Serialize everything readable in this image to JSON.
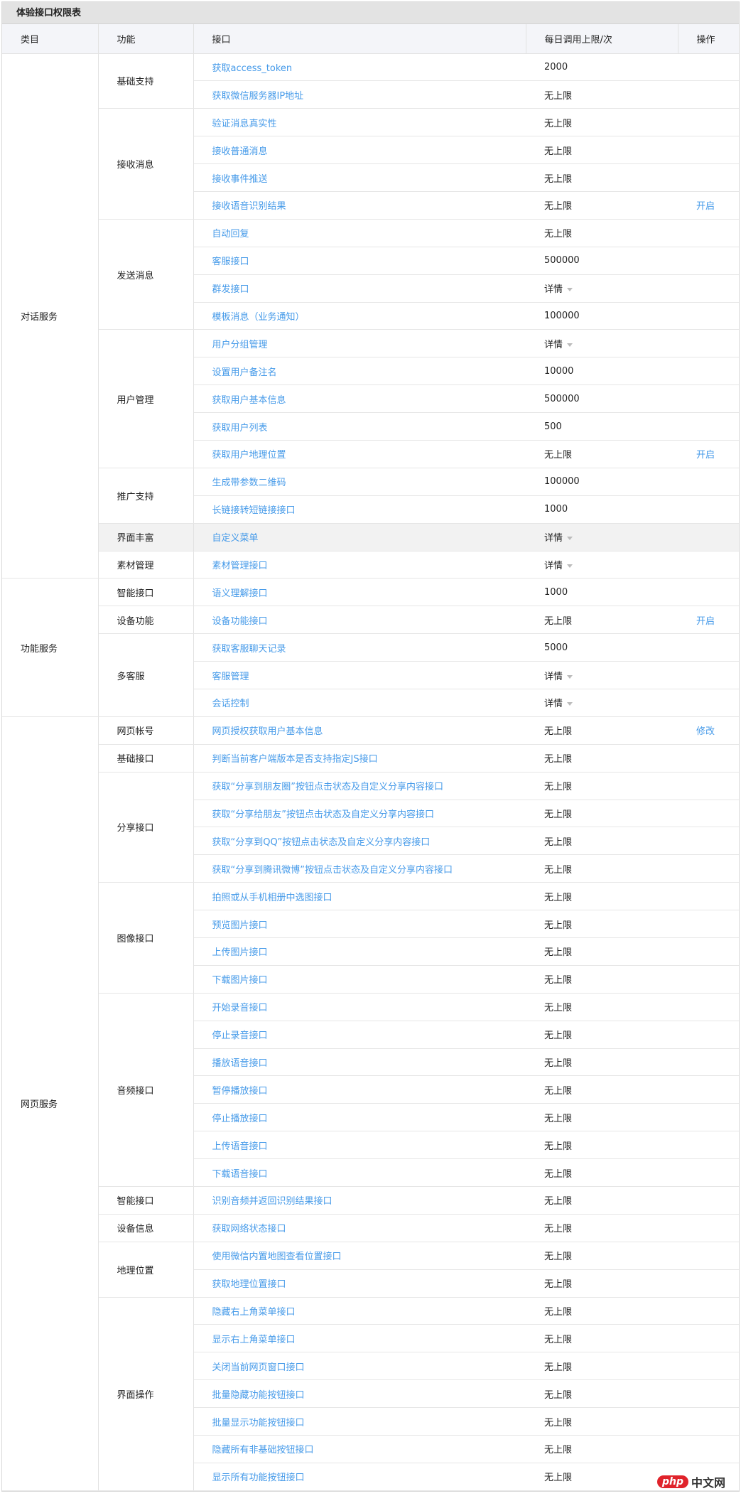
{
  "title": "体验接口权限表",
  "headers": [
    "类目",
    "功能",
    "接口",
    "每日调用上限/次",
    "操作"
  ],
  "colors": {
    "link": "#459ae9",
    "header_bg": "#f4f5f9",
    "title_bg": "#e3e3e3"
  },
  "categories": [
    {
      "name": "对话服务",
      "groups": [
        {
          "name": "基础支持",
          "apis": [
            {
              "name": "获取access_token",
              "limit": "2000"
            },
            {
              "name": "获取微信服务器IP地址",
              "limit": "无上限"
            }
          ]
        },
        {
          "name": "接收消息",
          "apis": [
            {
              "name": "验证消息真实性",
              "limit": "无上限"
            },
            {
              "name": "接收普通消息",
              "limit": "无上限"
            },
            {
              "name": "接收事件推送",
              "limit": "无上限"
            },
            {
              "name": "接收语音识别结果",
              "limit": "无上限",
              "action": "开启"
            }
          ]
        },
        {
          "name": "发送消息",
          "apis": [
            {
              "name": "自动回复",
              "limit": "无上限"
            },
            {
              "name": "客服接口",
              "limit": "500000"
            },
            {
              "name": "群发接口",
              "limit": "详情",
              "dropdown": true
            },
            {
              "name": "模板消息（业务通知）",
              "limit": "100000"
            }
          ]
        },
        {
          "name": "用户管理",
          "apis": [
            {
              "name": "用户分组管理",
              "limit": "详情",
              "dropdown": true
            },
            {
              "name": "设置用户备注名",
              "limit": "10000"
            },
            {
              "name": "获取用户基本信息",
              "limit": "500000"
            },
            {
              "name": "获取用户列表",
              "limit": "500"
            },
            {
              "name": "获取用户地理位置",
              "limit": "无上限",
              "action": "开启"
            }
          ]
        },
        {
          "name": "推广支持",
          "apis": [
            {
              "name": "生成带参数二维码",
              "limit": "100000"
            },
            {
              "name": "长链接转短链接接口",
              "limit": "1000"
            }
          ]
        },
        {
          "name": "界面丰富",
          "highlighted": true,
          "apis": [
            {
              "name": "自定义菜单",
              "limit": "详情",
              "dropdown": true
            }
          ]
        },
        {
          "name": "素材管理",
          "apis": [
            {
              "name": "素材管理接口",
              "limit": "详情",
              "dropdown": true
            }
          ]
        }
      ]
    },
    {
      "name": "功能服务",
      "groups": [
        {
          "name": "智能接口",
          "apis": [
            {
              "name": "语义理解接口",
              "limit": "1000"
            }
          ]
        },
        {
          "name": "设备功能",
          "apis": [
            {
              "name": "设备功能接口",
              "limit": "无上限",
              "action": "开启"
            }
          ]
        },
        {
          "name": "多客服",
          "apis": [
            {
              "name": "获取客服聊天记录",
              "limit": "5000"
            },
            {
              "name": "客服管理",
              "limit": "详情",
              "dropdown": true
            },
            {
              "name": "会话控制",
              "limit": "详情",
              "dropdown": true
            }
          ]
        }
      ]
    },
    {
      "name": "网页服务",
      "groups": [
        {
          "name": "网页帐号",
          "apis": [
            {
              "name": "网页授权获取用户基本信息",
              "limit": "无上限",
              "action": "修改"
            }
          ]
        },
        {
          "name": "基础接口",
          "apis": [
            {
              "name": "判断当前客户端版本是否支持指定JS接口",
              "limit": "无上限"
            }
          ]
        },
        {
          "name": "分享接口",
          "apis": [
            {
              "name": "获取“分享到朋友圈”按钮点击状态及自定义分享内容接口",
              "limit": "无上限"
            },
            {
              "name": "获取“分享给朋友”按钮点击状态及自定义分享内容接口",
              "limit": "无上限"
            },
            {
              "name": "获取“分享到QQ”按钮点击状态及自定义分享内容接口",
              "limit": "无上限"
            },
            {
              "name": "获取“分享到腾讯微博”按钮点击状态及自定义分享内容接口",
              "limit": "无上限"
            }
          ]
        },
        {
          "name": "图像接口",
          "apis": [
            {
              "name": "拍照或从手机相册中选图接口",
              "limit": "无上限"
            },
            {
              "name": "预览图片接口",
              "limit": "无上限"
            },
            {
              "name": "上传图片接口",
              "limit": "无上限"
            },
            {
              "name": "下载图片接口",
              "limit": "无上限"
            }
          ]
        },
        {
          "name": "音频接口",
          "apis": [
            {
              "name": "开始录音接口",
              "limit": "无上限"
            },
            {
              "name": "停止录音接口",
              "limit": "无上限"
            },
            {
              "name": "播放语音接口",
              "limit": "无上限"
            },
            {
              "name": "暂停播放接口",
              "limit": "无上限"
            },
            {
              "name": "停止播放接口",
              "limit": "无上限"
            },
            {
              "name": "上传语音接口",
              "limit": "无上限"
            },
            {
              "name": "下载语音接口",
              "limit": "无上限"
            }
          ]
        },
        {
          "name": "智能接口",
          "apis": [
            {
              "name": "识别音频并返回识别结果接口",
              "limit": "无上限"
            }
          ]
        },
        {
          "name": "设备信息",
          "apis": [
            {
              "name": "获取网络状态接口",
              "limit": "无上限"
            }
          ]
        },
        {
          "name": "地理位置",
          "apis": [
            {
              "name": "使用微信内置地图查看位置接口",
              "limit": "无上限"
            },
            {
              "name": "获取地理位置接口",
              "limit": "无上限"
            }
          ]
        },
        {
          "name": "界面操作",
          "apis": [
            {
              "name": "隐藏右上角菜单接口",
              "limit": "无上限"
            },
            {
              "name": "显示右上角菜单接口",
              "limit": "无上限"
            },
            {
              "name": "关闭当前网页窗口接口",
              "limit": "无上限"
            },
            {
              "name": "批量隐藏功能按钮接口",
              "limit": "无上限"
            },
            {
              "name": "批量显示功能按钮接口",
              "limit": "无上限"
            },
            {
              "name": "隐藏所有非基础按钮接口",
              "limit": "无上限"
            },
            {
              "name": "显示所有功能按钮接口",
              "limit": "无上限"
            }
          ]
        }
      ]
    }
  ],
  "watermark": {
    "logo": "php",
    "text": "中文网"
  }
}
